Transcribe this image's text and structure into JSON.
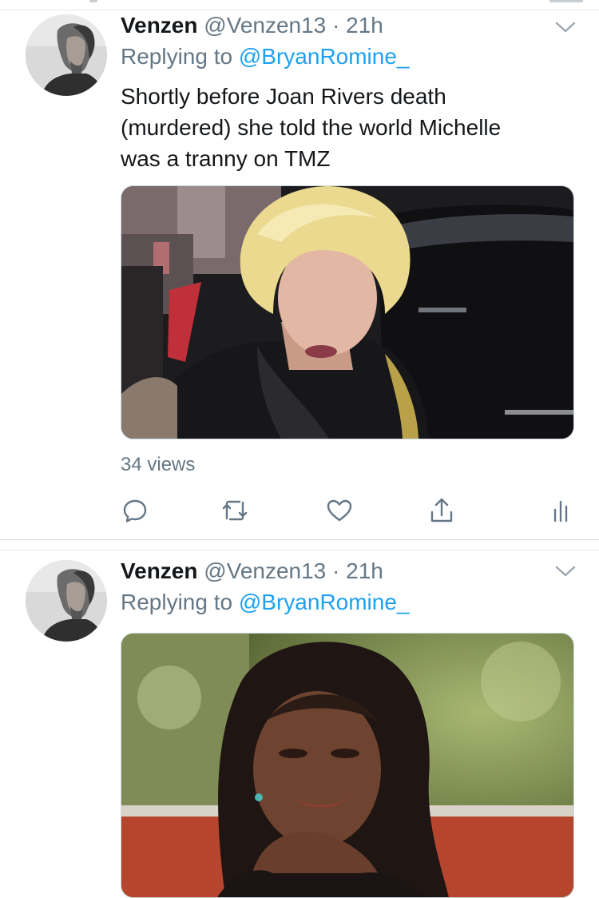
{
  "tweets": [
    {
      "author": {
        "name": "Venzen",
        "handle": "@Venzen13",
        "separator": "·",
        "time": "21h"
      },
      "reply": {
        "prefix": "Replying to",
        "mention": "@BryanRomine_"
      },
      "text_lines": [
        "Shortly before Joan Rivers death",
        "(murdered) she told the world Michelle",
        "was a tranny on TMZ"
      ],
      "media": {
        "kind": "video-thumbnail"
      },
      "views": "34 views",
      "actions": [
        "reply-icon",
        "retweet-icon",
        "like-icon",
        "share-icon",
        "analytics-icon"
      ]
    },
    {
      "author": {
        "name": "Venzen",
        "handle": "@Venzen13",
        "separator": "·",
        "time": "21h"
      },
      "reply": {
        "prefix": "Replying to",
        "mention": "@BryanRomine_"
      },
      "media": {
        "kind": "photo"
      }
    }
  ],
  "colors": {
    "link": "#1da1f2",
    "secondary_text": "#657786",
    "primary_text": "#14171a",
    "divider": "#e1e8ed"
  }
}
